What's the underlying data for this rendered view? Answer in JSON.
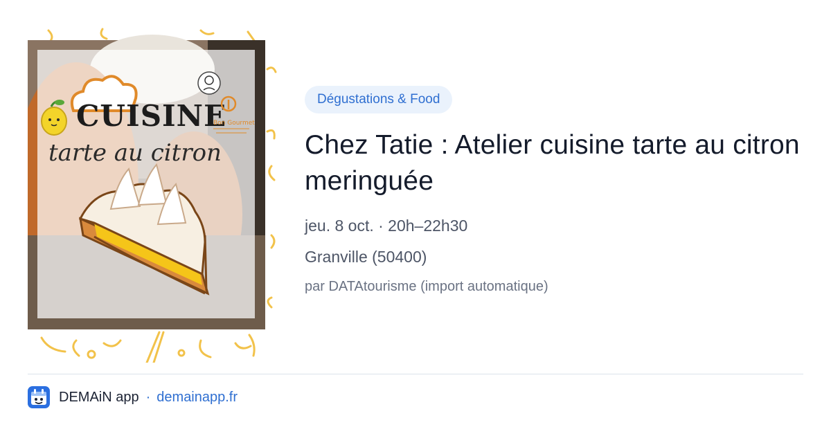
{
  "event": {
    "category": "Dégustations & Food",
    "title": "Chez Tatie : Atelier cuisine tarte au citron meringuée",
    "date_time": "jeu. 8 oct. · 20h–22h30",
    "location": "Granville (50400)",
    "source": "par DATAtourisme (import automatique)"
  },
  "poster": {
    "headline": "CUISINE",
    "subtitle": "tarte au citron",
    "logo_text": "Bon Gourmet"
  },
  "footer": {
    "app_name": "DEMAiN app",
    "separator": "·",
    "link": "demainapp.fr"
  },
  "colors": {
    "accent": "#2f6fd1",
    "tag_background": "#eaf2fc",
    "title": "#141b2b",
    "muted": "#4d5566"
  }
}
